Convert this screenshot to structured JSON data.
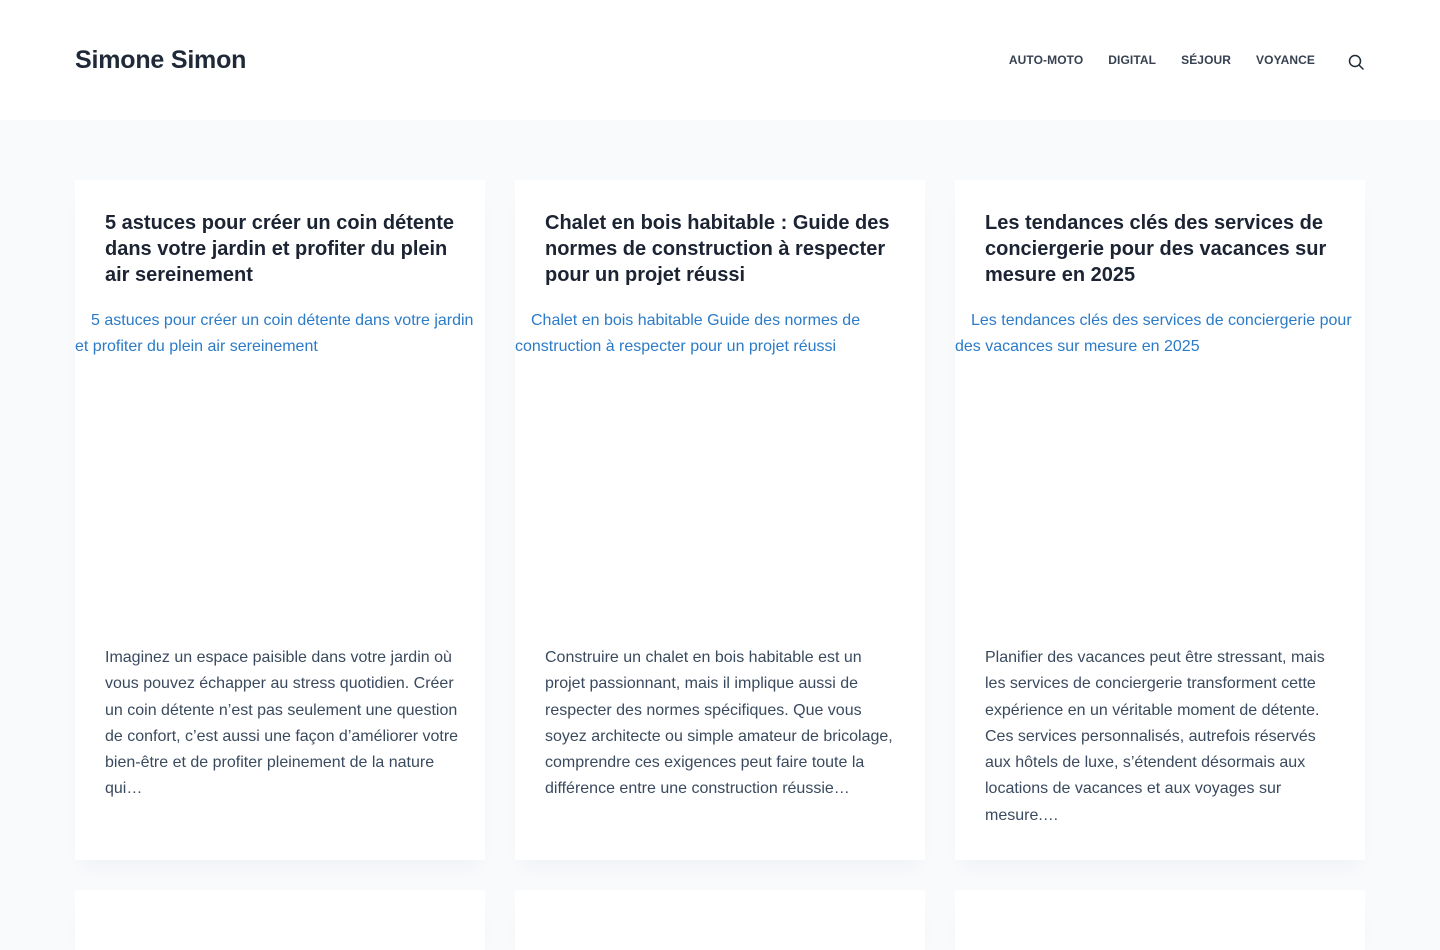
{
  "header": {
    "site_title": "Simone Simon",
    "nav": [
      "AUTO-MOTO",
      "DIGITAL",
      "SÉJOUR",
      "VOYANCE"
    ],
    "search_icon": "search-icon"
  },
  "posts": [
    {
      "title": "5 astuces pour créer un coin détente dans votre jardin et profiter du plein air sereinement",
      "image_alt": "5 astuces pour créer un coin détente dans votre jardin et profiter du plein air sereinement",
      "excerpt": "Imaginez un espace paisible dans votre jardin où vous pouvez échapper au stress quotidien. Créer un coin détente n’est pas seulement une question de confort, c’est aussi une façon d’améliorer votre bien-être et de profiter pleinement de la nature qui…"
    },
    {
      "title": "Chalet en bois habitable : Guide des normes de construction à respecter pour un projet réussi",
      "image_alt": "Chalet en bois habitable Guide des normes de construction à respecter pour un projet réussi",
      "excerpt": "Construire un chalet en bois habitable est un projet passionnant, mais il implique aussi de respecter des normes spécifiques. Que vous soyez architecte ou simple amateur de bricolage, comprendre ces exigences peut faire toute la différence entre une construction réussie…"
    },
    {
      "title": "Les tendances clés des services de conciergerie pour des vacances sur mesure en 2025",
      "image_alt": "Les tendances clés des services de conciergerie pour des vacances sur mesure en 2025",
      "excerpt": "Planifier des vacances peut être stressant, mais les services de conciergerie transforment cette expérience en un véritable moment de détente. Ces services personnalisés, autrefois réservés aux hôtels de luxe, s’étendent désormais aux locations de vacances et aux voyages sur mesure.…"
    }
  ]
}
